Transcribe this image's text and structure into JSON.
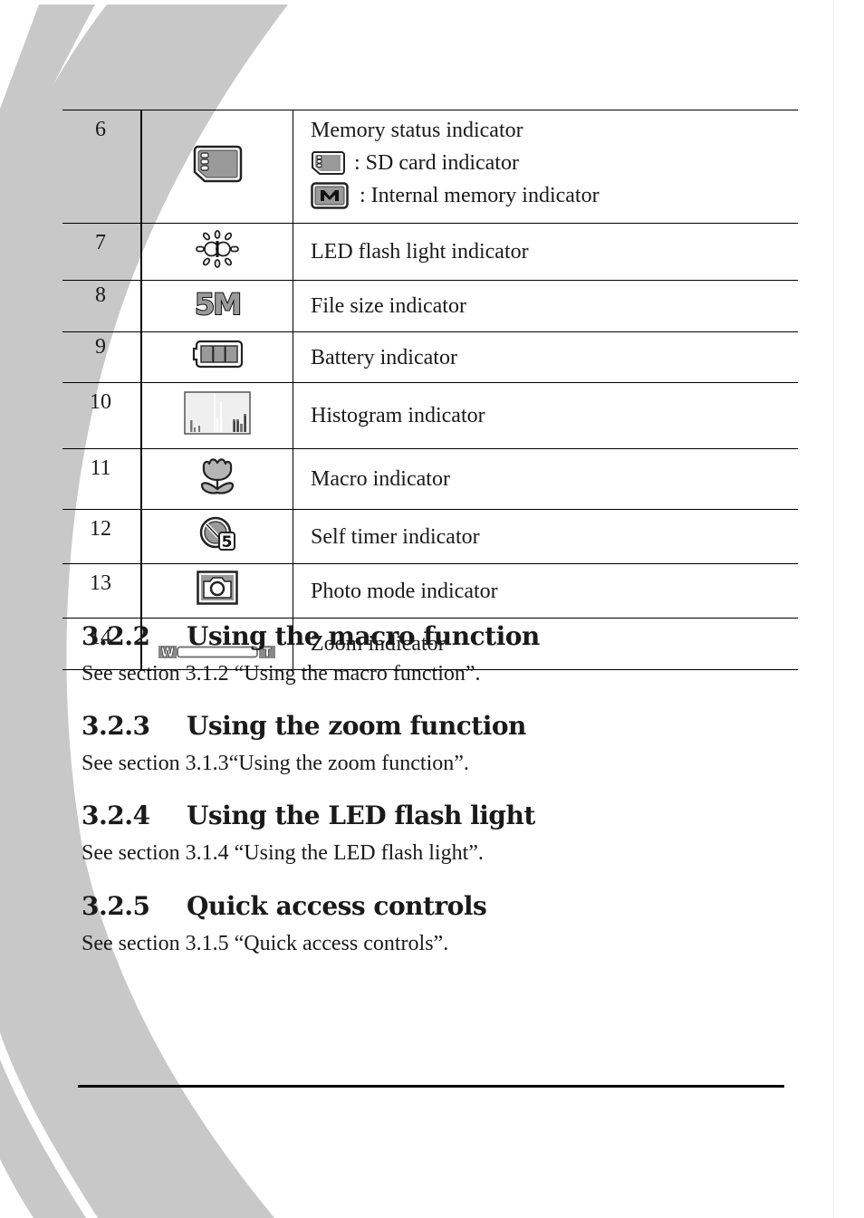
{
  "table": {
    "rows": [
      {
        "number": "6",
        "icon": "sd-card-icon",
        "description": "Memory status indicator",
        "sub_items": [
          {
            "icon": "sd-card-icon",
            "text": ": SD card indicator"
          },
          {
            "icon": "internal-memory-icon",
            "text": ": Internal memory indicator"
          }
        ]
      },
      {
        "number": "7",
        "icon": "led-flash-icon",
        "description": "LED flash light indicator"
      },
      {
        "number": "8",
        "icon": "file-size-5m-icon",
        "icon_text": "5M",
        "description": "File size indicator"
      },
      {
        "number": "9",
        "icon": "battery-icon",
        "description": "Battery indicator"
      },
      {
        "number": "10",
        "icon": "histogram-icon",
        "description": "Histogram indicator"
      },
      {
        "number": "11",
        "icon": "macro-flower-icon",
        "description": "Macro indicator"
      },
      {
        "number": "12",
        "icon": "self-timer-icon",
        "icon_text": "5",
        "description": "Self timer indicator"
      },
      {
        "number": "13",
        "icon": "photo-mode-camera-icon",
        "description": "Photo mode indicator"
      },
      {
        "number": "14",
        "icon": "zoom-bar-icon",
        "icon_text_wide": "W",
        "icon_text_tele": "T",
        "description": "Zoom indicator"
      }
    ]
  },
  "sections": [
    {
      "number": "3.2.2",
      "title": "Using the macro function",
      "body": "See section 3.1.2 “Using the macro function”."
    },
    {
      "number": "3.2.3",
      "title": "Using the zoom function",
      "body": "See section 3.1.3“Using the zoom function”."
    },
    {
      "number": "3.2.4",
      "title": "Using the LED flash light",
      "body": "See section 3.1.4 “Using the LED flash light”."
    },
    {
      "number": "3.2.5",
      "title": "Quick access controls",
      "body": "See section 3.1.5 “Quick access controls”."
    }
  ],
  "colors": {
    "swoosh": "#c8c8c8",
    "icon_fill": "#9a9a9a",
    "rule": "#000000"
  }
}
